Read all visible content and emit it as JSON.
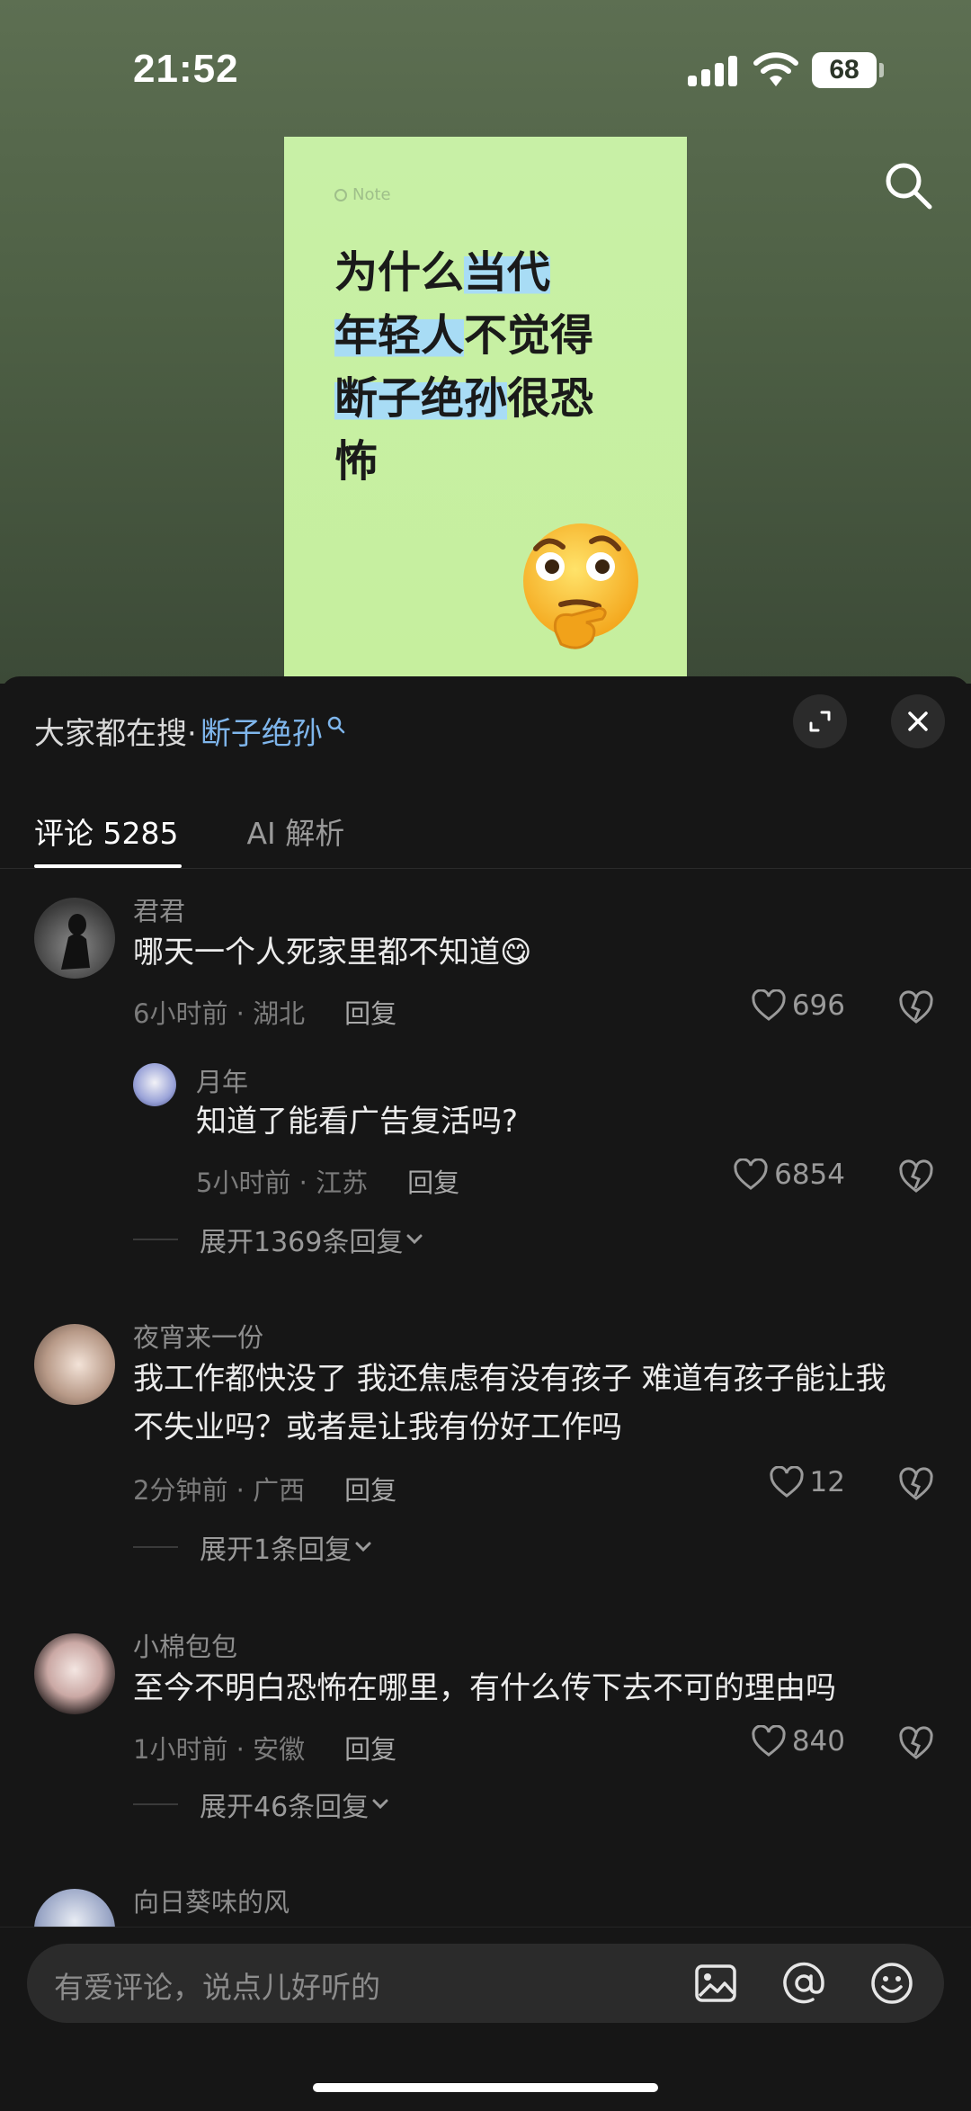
{
  "status_bar": {
    "time": "21:52",
    "battery": "68",
    "icons": [
      "signal-icon",
      "wifi-icon",
      "battery-icon"
    ]
  },
  "header": {
    "search_icon": "search-icon"
  },
  "note_card": {
    "label": "Note",
    "title_parts": [
      {
        "text": "为什么",
        "highlight": false
      },
      {
        "text": "当代",
        "highlight": true
      },
      {
        "text": "年轻人",
        "highlight": true
      },
      {
        "text": "不觉得",
        "highlight": false
      },
      {
        "text": "断子绝孙",
        "highlight": true
      },
      {
        "text": "很恐",
        "highlight": false
      },
      {
        "text": "怖",
        "highlight": false
      }
    ],
    "emoji": "thinking-face"
  },
  "panel": {
    "hot_search_prefix": "大家都在搜·",
    "hot_search_keyword": "断子绝孙",
    "expand_icon": "expand-icon",
    "close_icon": "close-icon",
    "tabs": [
      {
        "label": "评论 5285",
        "active": true
      },
      {
        "label": "AI 解析",
        "active": false
      }
    ]
  },
  "comments": [
    {
      "username": "君君",
      "text": "哪天一个人死家里都不知道",
      "emoji": "😋",
      "time_location": "6小时前 · 湖北",
      "reply_label": "回复",
      "likes": "696",
      "sub_reply": {
        "username": "月年",
        "text": "知道了能看广告复活吗?",
        "time_location": "5小时前 · 江苏",
        "reply_label": "回复",
        "likes": "6854"
      },
      "expand_label": "展开1369条回复"
    },
    {
      "username": "夜宵来一份",
      "text_lines": [
        "我工作都快没了 我还焦虑有没有孩子 难道有孩子能让我",
        "不失业吗？或者是让我有份好工作吗"
      ],
      "time_location": "2分钟前 · 广西",
      "reply_label": "回复",
      "likes": "12",
      "expand_label": "展开1条回复"
    },
    {
      "username": "小棉包包",
      "text": "至今不明白恐怖在哪里，有什么传下去不可的理由吗",
      "time_location": "1小时前 · 安徽",
      "reply_label": "回复",
      "likes": "840",
      "expand_label": "展开46条回复"
    },
    {
      "username": "向日葵味的风"
    }
  ],
  "input_bar": {
    "placeholder": "有爱评论，说点儿好听的",
    "icons": [
      "image-icon",
      "at-icon",
      "emoji-icon"
    ]
  }
}
